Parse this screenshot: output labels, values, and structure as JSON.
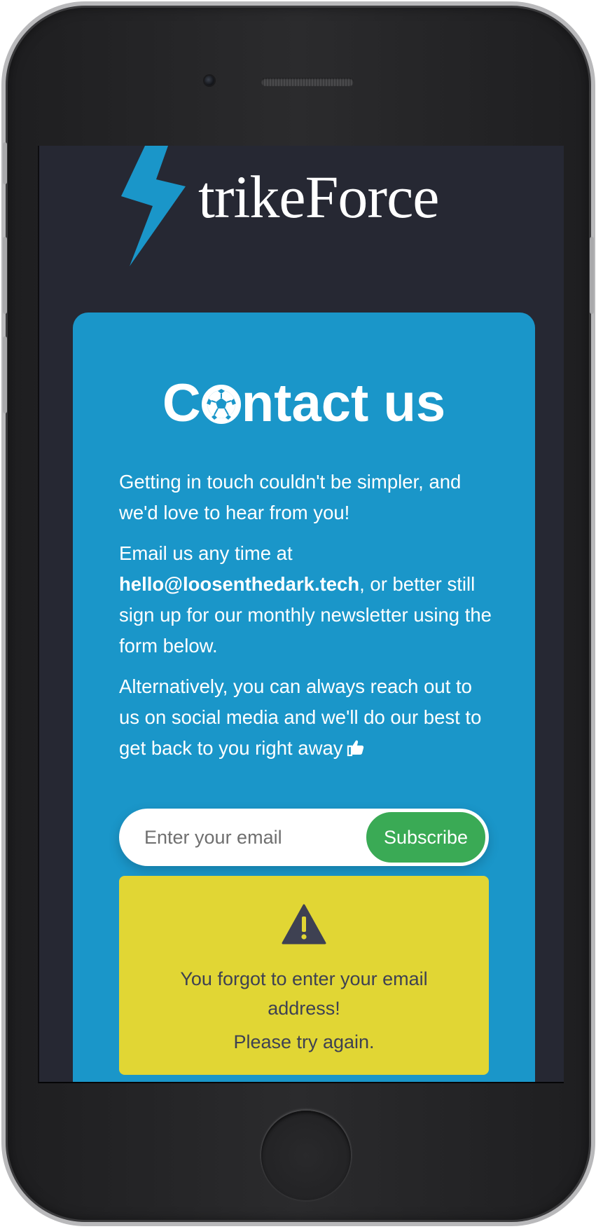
{
  "device": {
    "frame_color": "#2b2b2d",
    "bezel_color": "#b9b9bb"
  },
  "logo": {
    "icon": "lightning-bolt-icon",
    "text": "trikeForce",
    "accent_color": "#1a96c9"
  },
  "contact": {
    "title_prefix": "C",
    "title_ball_icon": "soccer-ball-icon",
    "title_suffix": "ntact us",
    "paragraph_1": "Getting in touch couldn't be simpler, and we'd love to hear from you!",
    "paragraph_2_pre": "Email us any time at ",
    "email": "hello@loosenthedark.tech",
    "paragraph_2_post": ", or better still sign up for our monthly newsletter using the form below.",
    "paragraph_3": "Alternatively, you can always reach out to us on social media and we'll do our best to get back to you right away",
    "paragraph_3_icon": "thumbs-up-icon",
    "card_color": "#1a96c9"
  },
  "newsletter": {
    "email_placeholder": "Enter your email",
    "email_value": "",
    "subscribe_label": "Subscribe",
    "button_color": "#3aaa55"
  },
  "alert": {
    "icon": "warning-icon",
    "message_line_1": "You forgot to enter your email address!",
    "message_line_2": "Please try again.",
    "color": "#e1d634"
  },
  "colors": {
    "screen_bg": "#262833",
    "text": "#ffffff",
    "alert_text": "#3e4152"
  }
}
